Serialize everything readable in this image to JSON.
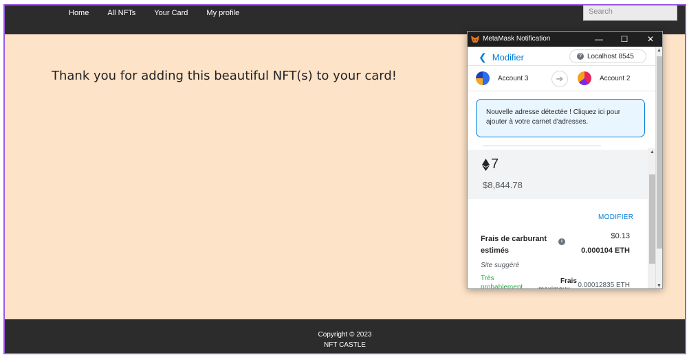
{
  "site": {
    "nav": [
      "Home",
      "All NFTs",
      "Your Card",
      "My profile"
    ],
    "search_placeholder": "Search",
    "thank_you": "Thank you for adding this beautiful NFT(s) to your card!",
    "footer": {
      "copyright": "Copyright © 2023",
      "brand": "NFT CASTLE"
    }
  },
  "metamask": {
    "window_title": "MetaMask Notification",
    "back_label": "Modifier",
    "network": "Localhost 8545",
    "from_account": "Account 3",
    "to_account": "Account 2",
    "notice": "Nouvelle adresse détectée ! Cliquez ici pour ajouter à votre carnet d'adresses.",
    "amount_eth": "7",
    "amount_fiat": "$8,844.78",
    "edit_label": "MODIFIER",
    "fee_label": "Frais de carburant estimés",
    "fee_usd": "$0.13",
    "fee_eth": "0.000104 ETH",
    "suggested": "Site suggéré",
    "likely": "Très probablement",
    "max_fee_label": "Frais",
    "max_fee_sublabel": "maximaux",
    "max_fee_value": "0.00012835 ETH",
    "window_buttons": {
      "minimize": "—",
      "maximize": "☐",
      "close": "✕"
    },
    "colors": {
      "accent": "#037dd6",
      "success": "#28a745",
      "notice_bg": "#eaf6ff"
    }
  },
  "colors": {
    "frame": "#9b59e6",
    "navbar": "#2c2c2c",
    "page_bg": "#fde3c8"
  }
}
